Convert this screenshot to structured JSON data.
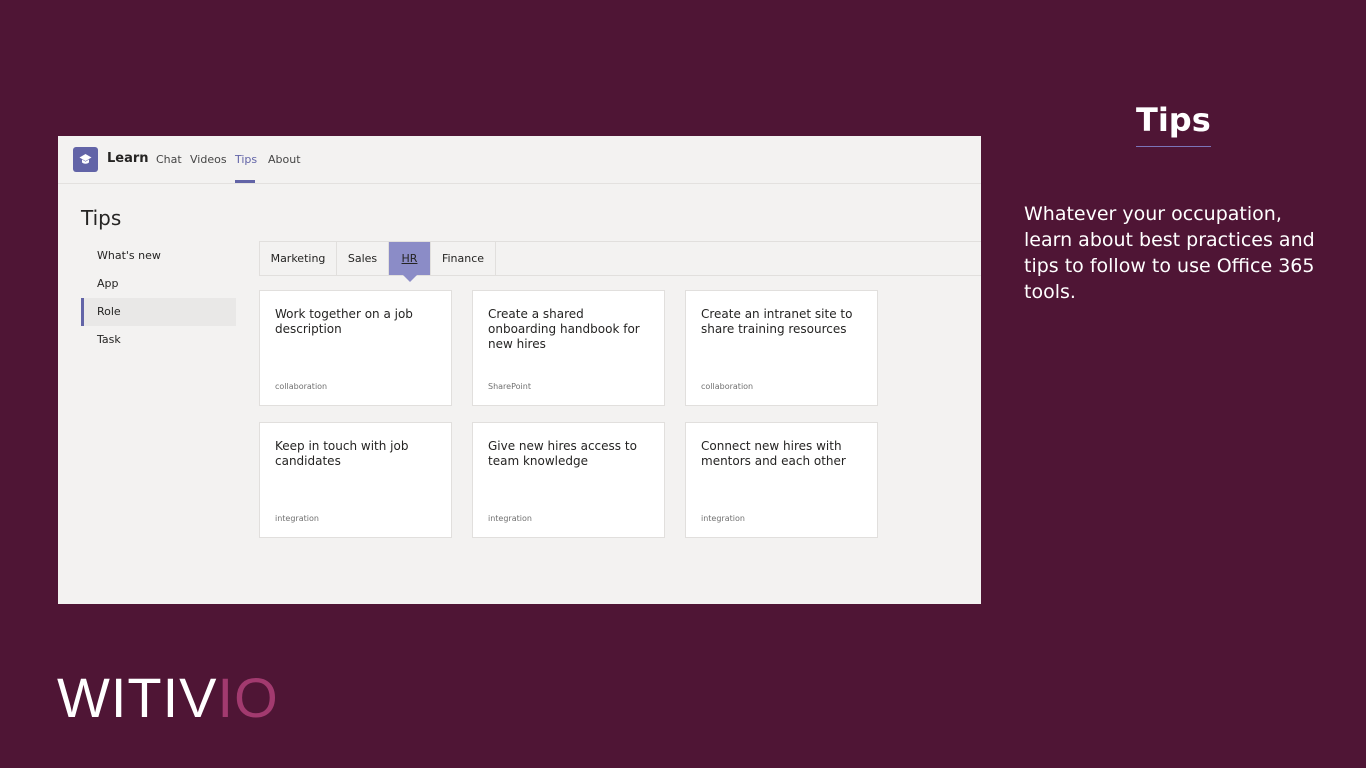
{
  "slide": {
    "title": "Tips",
    "description": "Whatever your occupation, learn about best practices and tips to follow to use Office 365 tools."
  },
  "logo": {
    "main": "WITIV",
    "accent": "IO"
  },
  "colors": {
    "background": "#4f1535",
    "brand_accent": "#a23a6f",
    "teams_purple": "#6264a7",
    "active_tab": "#8b8cc7"
  },
  "app": {
    "icon": "learn-app-icon",
    "name": "Learn",
    "nav_tabs": [
      {
        "label": "Chat"
      },
      {
        "label": "Videos"
      },
      {
        "label": "Tips",
        "active": true
      },
      {
        "label": "About"
      }
    ],
    "page_heading": "Tips",
    "sidebar": [
      {
        "label": "What's new"
      },
      {
        "label": "App"
      },
      {
        "label": "Role",
        "active": true
      },
      {
        "label": "Task"
      }
    ],
    "category_tabs": [
      {
        "label": "Marketing"
      },
      {
        "label": "Sales"
      },
      {
        "label": "HR",
        "active": true
      },
      {
        "label": "Finance"
      }
    ],
    "cards": [
      {
        "title": "Work together on a job description",
        "tag": "collaboration"
      },
      {
        "title": "Create a shared onboarding handbook for new hires",
        "tag": "SharePoint"
      },
      {
        "title": "Create an intranet site to share training resources",
        "tag": "collaboration"
      },
      {
        "title": "Keep in touch with job candidates",
        "tag": "integration"
      },
      {
        "title": "Give new hires access to team knowledge",
        "tag": "integration"
      },
      {
        "title": "Connect new hires with mentors and each other",
        "tag": "integration"
      }
    ]
  }
}
